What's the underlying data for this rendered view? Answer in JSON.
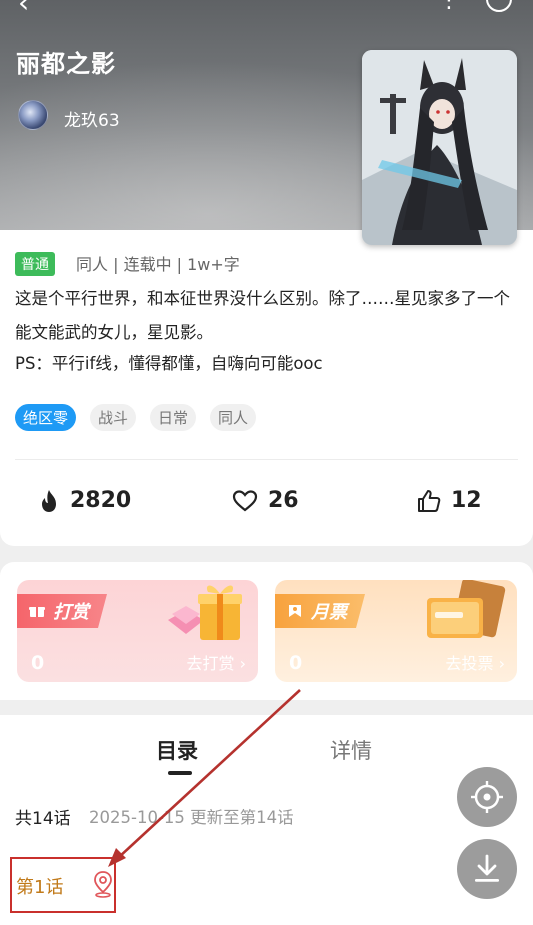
{
  "hero": {
    "title": "丽都之影",
    "author": "龙玖63"
  },
  "info": {
    "badge": "普通",
    "meta": "同人 | 连载中 | 1w+字",
    "description": "这是个平行世界，和本征世界没什么区别。除了……星见家多了一个能文能武的女儿，星见影。",
    "ps": "PS：平行if线，懂得都懂，自嗨向可能ooc",
    "tags": [
      "绝区零",
      "战斗",
      "日常",
      "同人"
    ]
  },
  "stats": {
    "heat": "2820",
    "likes": "26",
    "thumbs": "12"
  },
  "reward": {
    "title": "打赏",
    "count": "0",
    "action": "去打赏 ›"
  },
  "monthly": {
    "title": "月票",
    "count": "0",
    "action": "去投票 ›"
  },
  "tabs": {
    "catalog": "目录",
    "details": "详情"
  },
  "catalog": {
    "total": "共14话",
    "update": "2025-10-15 更新至第14话",
    "first_chapter": "第1话"
  },
  "colors": {
    "accent_tag": "#1e9af5",
    "badge": "#3dbb5a",
    "highlight_box": "#c9302c",
    "chapter_text": "#c17a1a"
  }
}
